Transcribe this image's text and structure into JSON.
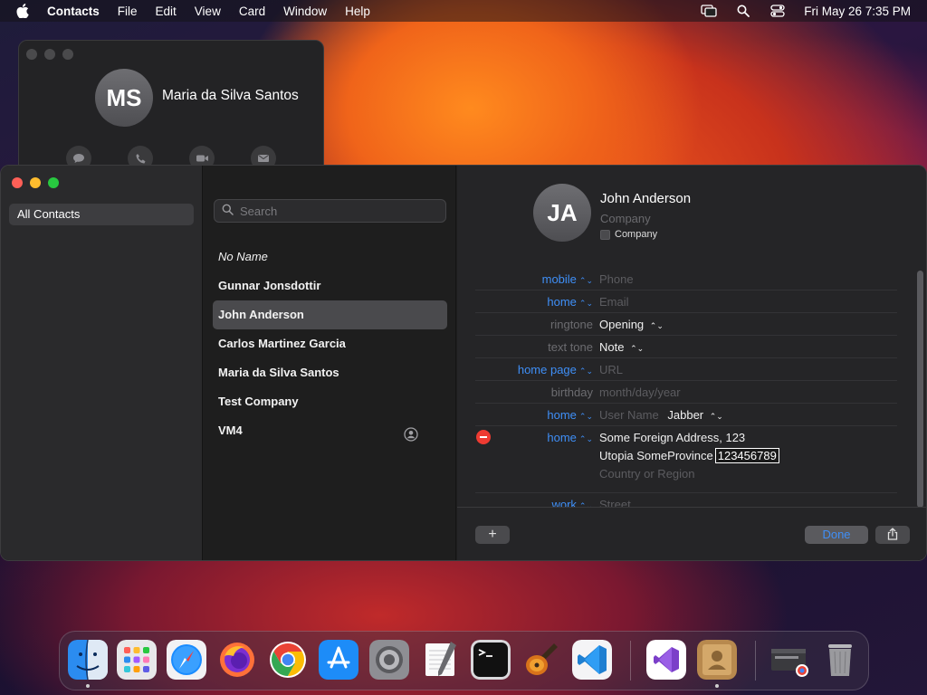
{
  "menubar": {
    "apple_icon": "apple-logo-icon",
    "app_name": "Contacts",
    "menus": [
      "File",
      "Edit",
      "View",
      "Card",
      "Window",
      "Help"
    ],
    "status_icons": [
      "screen-mirroring-icon",
      "spotlight-search-icon",
      "control-center-icon"
    ],
    "datetime": "Fri May 26  7:35 PM"
  },
  "card_window": {
    "initials": "MS",
    "name": "Maria da Silva Santos",
    "actions": [
      "message-icon",
      "phone-icon",
      "video-icon",
      "mail-icon"
    ]
  },
  "sidebar": {
    "items": [
      {
        "label": "All Contacts"
      }
    ]
  },
  "list": {
    "search_placeholder": "Search",
    "contacts": [
      {
        "name": "No Name"
      },
      {
        "name": "Gunnar Jonsdottir"
      },
      {
        "name": "John Anderson"
      },
      {
        "name": "Carlos Martinez Garcia"
      },
      {
        "name": "Maria da Silva Santos"
      },
      {
        "name": "Test Company"
      },
      {
        "name": "VM4"
      }
    ]
  },
  "detail": {
    "initials": "JA",
    "name": "John  Anderson",
    "company_placeholder": "Company",
    "company_checkbox_label": "Company",
    "fields": {
      "mobile": {
        "label": "mobile",
        "value": "Phone"
      },
      "home_email": {
        "label": "home",
        "value": "Email"
      },
      "ringtone": {
        "label": "ringtone",
        "value": "Opening"
      },
      "texttone": {
        "label": "text tone",
        "value": "Note"
      },
      "homepage": {
        "label": "home page",
        "value": "URL"
      },
      "birthday": {
        "label": "birthday",
        "value": "month/day/year"
      },
      "im": {
        "label": "home",
        "username_placeholder": "User Name",
        "service": "Jabber"
      },
      "address": {
        "label": "home",
        "street": "Some Foreign Address, 123",
        "city_province": "Utopia SomeProvince",
        "zip": "123456789",
        "country_placeholder": "Country or Region"
      },
      "work_address": {
        "label": "work",
        "value": "Street"
      }
    },
    "add_label": "+",
    "done_label": "Done",
    "share_icon": "share-icon"
  },
  "dock": {
    "apps": [
      "finder-icon",
      "launchpad-icon",
      "safari-icon",
      "firefox-icon",
      "chrome-icon",
      "app-store-icon",
      "system-settings-icon",
      "textedit-icon",
      "terminal-icon",
      "garageband-icon",
      "vscode-icon",
      "visual-studio-icon",
      "contacts-icon",
      "chrome-window-icon",
      "trash-icon"
    ]
  }
}
